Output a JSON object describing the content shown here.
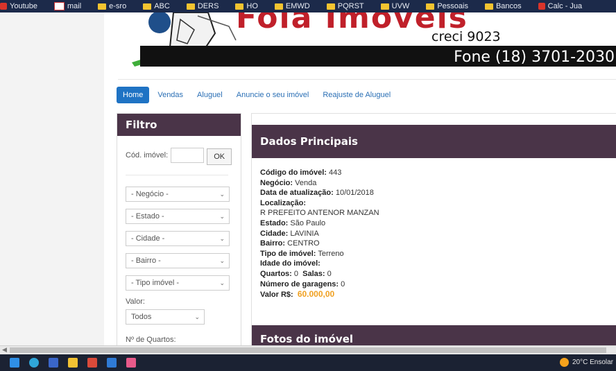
{
  "bookmarks": [
    {
      "label": "Youtube",
      "icon": "red-icon"
    },
    {
      "label": "mail",
      "icon": "mail-icon"
    },
    {
      "label": "e-sro",
      "icon": "folder-icon"
    },
    {
      "label": "ABC",
      "icon": "folder-icon"
    },
    {
      "label": "DERS",
      "icon": "folder-icon"
    },
    {
      "label": "HO",
      "icon": "folder-icon"
    },
    {
      "label": "EMWD",
      "icon": "folder-icon"
    },
    {
      "label": "PQRST",
      "icon": "folder-icon"
    },
    {
      "label": "UVW",
      "icon": "folder-icon"
    },
    {
      "label": "Pessoais",
      "icon": "folder-icon"
    },
    {
      "label": "Bancos",
      "icon": "folder-icon"
    },
    {
      "label": "Calc - Jua",
      "icon": "folder-icon"
    }
  ],
  "header": {
    "brand": "Fola Imóveis",
    "creci": "creci 9023",
    "phone": "Fone (18) 3701-2030"
  },
  "nav": [
    "Home",
    "Vendas",
    "Aluguel",
    "Anuncie o seu imóvel",
    "Reajuste de Aluguel"
  ],
  "filter": {
    "title": "Filtro",
    "cod_label": "Cód. imóvel:",
    "ok_label": "OK",
    "selects": [
      "- Negócio -",
      "- Estado -",
      "- Cidade -",
      "- Bairro -",
      "- Tipo imóvel -"
    ],
    "valor_label": "Valor:",
    "valor_value": "Todos",
    "quartos_label": "Nº de Quartos:"
  },
  "main": {
    "title": "Dados Principais",
    "codigo_label": "Código do imóvel:",
    "codigo": "443",
    "negocio_label": "Negócio:",
    "negocio": "Venda",
    "atualizacao_label": "Data de atualização:",
    "atualizacao": "10/01/2018",
    "localizacao_label": "Localização:",
    "endereco": "R PREFEITO ANTENOR MANZAN",
    "estado_label": "Estado:",
    "estado": "São Paulo",
    "cidade_label": "Cidade:",
    "cidade": "LAVINIA",
    "bairro_label": "Bairro:",
    "bairro": "CENTRO",
    "tipo_label": "Tipo de imóvel:",
    "tipo": "Terreno",
    "idade_label": "Idade do imóvel:",
    "quartos_label": "Quartos:",
    "quartos": "0",
    "salas_label": "Salas:",
    "salas": "0",
    "garagens_label": "Número de garagens:",
    "garagens": "0",
    "valor_label": "Valor R$:",
    "valor": "60.000,00",
    "photos_title": "Fotos do imóvel"
  },
  "taskbar": {
    "weather": "20°C  Ensolar"
  },
  "colors": {
    "panel_header": "#4a3448",
    "nav_active": "#1f73c4",
    "price": "#f0a020"
  }
}
